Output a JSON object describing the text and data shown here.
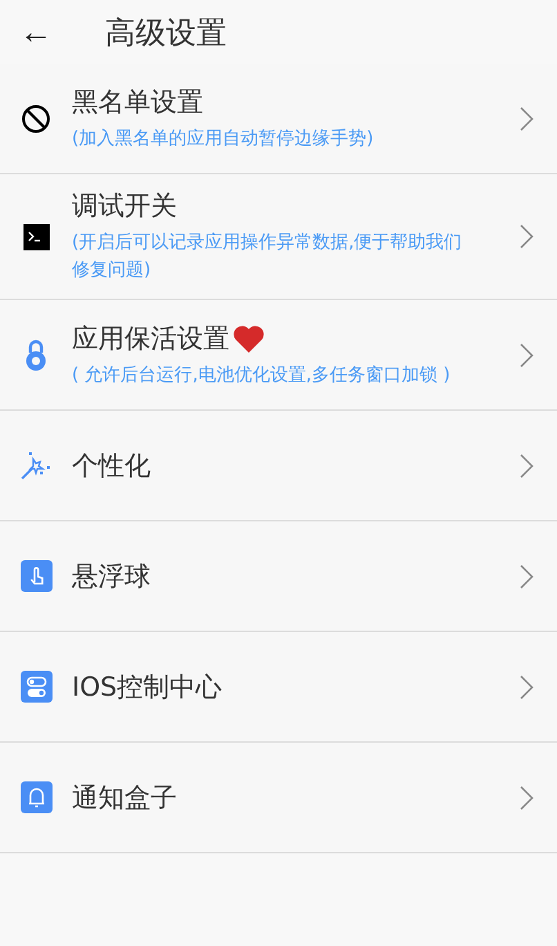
{
  "header": {
    "back": "←",
    "title": "高级设置"
  },
  "items": [
    {
      "kind": "block",
      "title": "黑名单设置",
      "heart": false,
      "subtitle": "(加入黑名单的应用自动暂停边缘手势)"
    },
    {
      "kind": "terminal",
      "title": "调试开关",
      "heart": false,
      "subtitle": "(开启后可以记录应用操作异常数据,便于帮助我们修复问题)"
    },
    {
      "kind": "lock",
      "title": "应用保活设置",
      "heart": true,
      "subtitle": "( 允许后台运行,电池优化设置,多任务窗口加锁 )"
    },
    {
      "kind": "magic",
      "title": "个性化",
      "heart": false
    },
    {
      "kind": "touch",
      "title": "悬浮球",
      "heart": false
    },
    {
      "kind": "toggle",
      "title": "IOS控制中心",
      "heart": false
    },
    {
      "kind": "bell",
      "title": "通知盒子",
      "heart": false
    }
  ]
}
